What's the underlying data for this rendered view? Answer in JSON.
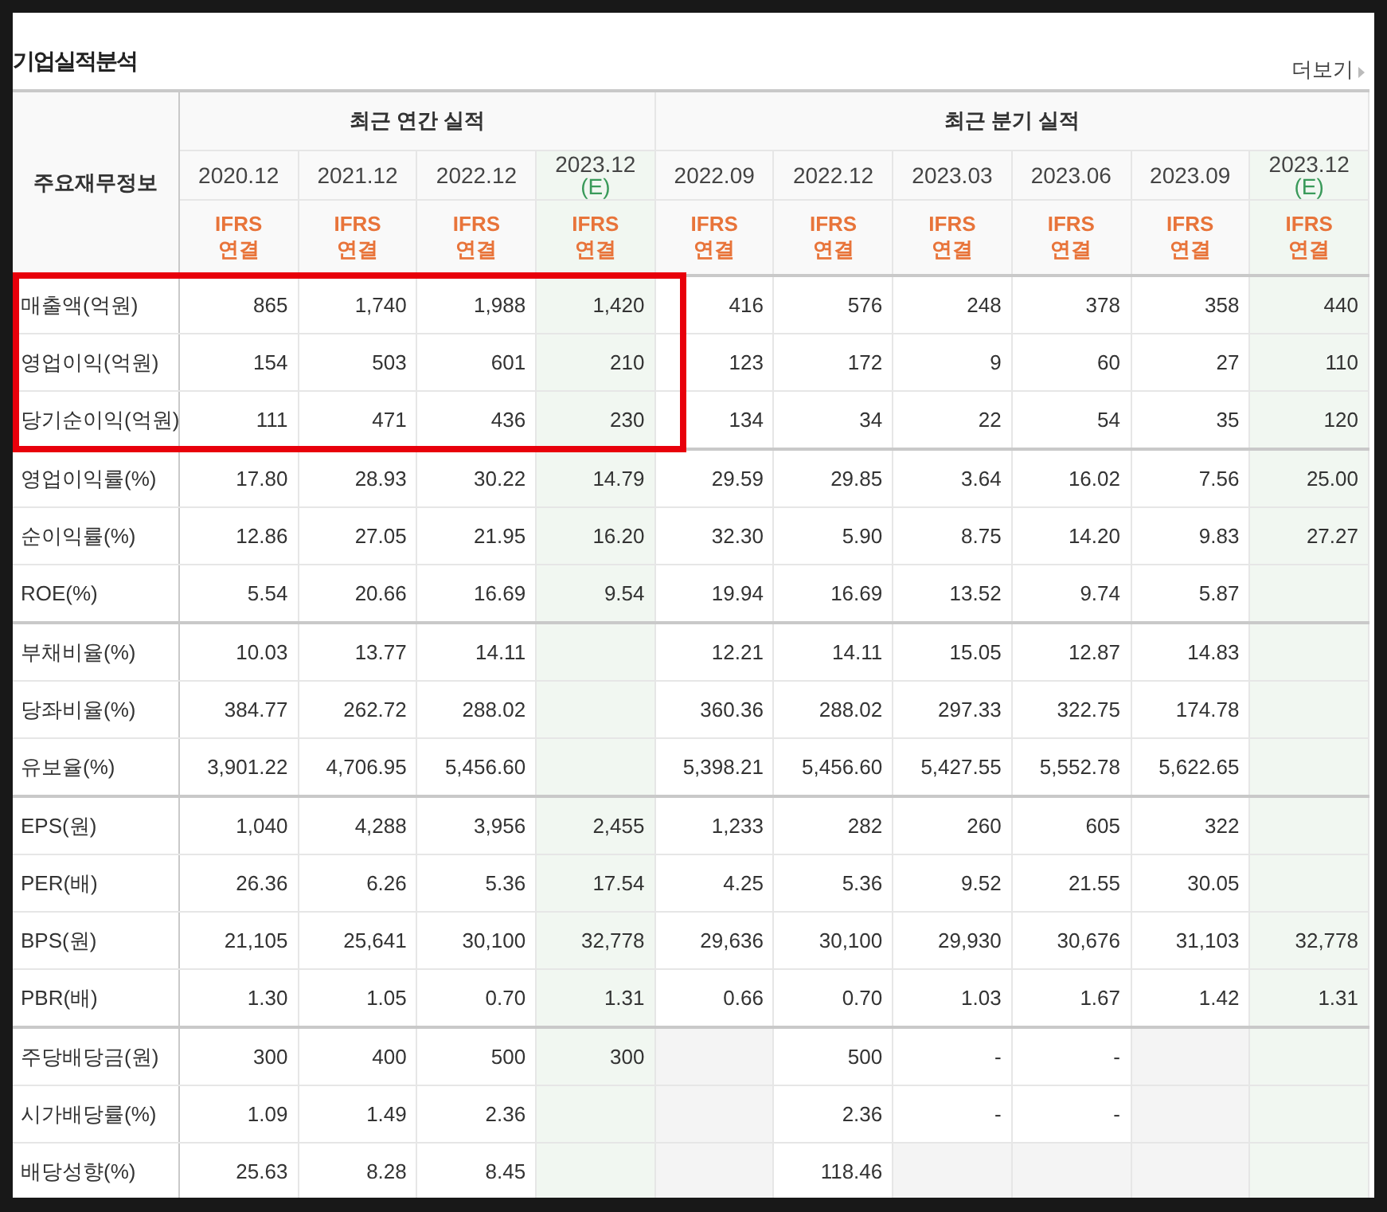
{
  "section_title": "기업실적분석",
  "more_link": "더보기",
  "row_header": "주요재무정보",
  "column_groups": [
    {
      "title": "최근 연간 실적",
      "highlighted": true,
      "columns": [
        {
          "period": "2020.12",
          "basis": [
            "IFRS",
            "연결"
          ]
        },
        {
          "period": "2021.12",
          "basis": [
            "IFRS",
            "연결"
          ]
        },
        {
          "period": "2022.12",
          "basis": [
            "IFRS",
            "연결"
          ]
        },
        {
          "period": "2023.12",
          "estimate": true,
          "estimate_mark": "(E)",
          "basis": [
            "IFRS",
            "연결"
          ]
        }
      ]
    },
    {
      "title": "최근 분기 실적",
      "columns": [
        {
          "period": "2022.09",
          "basis": [
            "IFRS",
            "연결"
          ]
        },
        {
          "period": "2022.12",
          "basis": [
            "IFRS",
            "연결"
          ]
        },
        {
          "period": "2023.03",
          "basis": [
            "IFRS",
            "연결"
          ]
        },
        {
          "period": "2023.06",
          "basis": [
            "IFRS",
            "연결"
          ]
        },
        {
          "period": "2023.09",
          "basis": [
            "IFRS",
            "연결"
          ]
        },
        {
          "period": "2023.12",
          "estimate": true,
          "estimate_mark": "(E)",
          "basis": [
            "IFRS",
            "연결"
          ]
        }
      ]
    }
  ],
  "row_groups": [
    {
      "highlighted": true,
      "rows": [
        {
          "label": "매출액(억원)",
          "cells": [
            {
              "text": "865"
            },
            {
              "text": "1,740"
            },
            {
              "text": "1,988"
            },
            {
              "text": "1,420"
            },
            {
              "text": "416"
            },
            {
              "text": "576"
            },
            {
              "text": "248"
            },
            {
              "text": "378"
            },
            {
              "text": "358"
            },
            {
              "text": "440"
            }
          ]
        },
        {
          "label": "영업이익(억원)",
          "cells": [
            {
              "text": "154"
            },
            {
              "text": "503"
            },
            {
              "text": "601"
            },
            {
              "text": "210"
            },
            {
              "text": "123"
            },
            {
              "text": "172"
            },
            {
              "text": "9"
            },
            {
              "text": "60"
            },
            {
              "text": "27"
            },
            {
              "text": "110"
            }
          ]
        },
        {
          "label": "당기순이익(억원)",
          "cells": [
            {
              "text": "111"
            },
            {
              "text": "471"
            },
            {
              "text": "436"
            },
            {
              "text": "230"
            },
            {
              "text": "134"
            },
            {
              "text": "34"
            },
            {
              "text": "22"
            },
            {
              "text": "54"
            },
            {
              "text": "35"
            },
            {
              "text": "120"
            }
          ]
        }
      ]
    },
    {
      "rows": [
        {
          "label": "영업이익률(%)",
          "cells": [
            {
              "text": "17.80"
            },
            {
              "text": "28.93"
            },
            {
              "text": "30.22"
            },
            {
              "text": "14.79"
            },
            {
              "text": "29.59"
            },
            {
              "text": "29.85"
            },
            {
              "text": "3.64"
            },
            {
              "text": "16.02"
            },
            {
              "text": "7.56"
            },
            {
              "text": "25.00"
            }
          ]
        },
        {
          "label": "순이익률(%)",
          "cells": [
            {
              "text": "12.86"
            },
            {
              "text": "27.05"
            },
            {
              "text": "21.95"
            },
            {
              "text": "16.20"
            },
            {
              "text": "32.30"
            },
            {
              "text": "5.90"
            },
            {
              "text": "8.75"
            },
            {
              "text": "14.20"
            },
            {
              "text": "9.83"
            },
            {
              "text": "27.27"
            }
          ]
        },
        {
          "label": "ROE(%)",
          "cells": [
            {
              "text": "5.54"
            },
            {
              "text": "20.66"
            },
            {
              "text": "16.69"
            },
            {
              "text": "9.54"
            },
            {
              "text": "19.94"
            },
            {
              "text": "16.69"
            },
            {
              "text": "13.52"
            },
            {
              "text": "9.74"
            },
            {
              "text": "5.87"
            },
            {
              "blank": true
            }
          ]
        }
      ]
    },
    {
      "rows": [
        {
          "label": "부채비율(%)",
          "cells": [
            {
              "text": "10.03"
            },
            {
              "text": "13.77"
            },
            {
              "text": "14.11"
            },
            {
              "blank": true
            },
            {
              "text": "12.21"
            },
            {
              "text": "14.11"
            },
            {
              "text": "15.05"
            },
            {
              "text": "12.87"
            },
            {
              "text": "14.83"
            },
            {
              "blank": true
            }
          ]
        },
        {
          "label": "당좌비율(%)",
          "cells": [
            {
              "text": "384.77"
            },
            {
              "text": "262.72"
            },
            {
              "text": "288.02"
            },
            {
              "blank": true
            },
            {
              "text": "360.36"
            },
            {
              "text": "288.02"
            },
            {
              "text": "297.33"
            },
            {
              "text": "322.75"
            },
            {
              "text": "174.78"
            },
            {
              "blank": true
            }
          ]
        },
        {
          "label": "유보율(%)",
          "cells": [
            {
              "text": "3,901.22"
            },
            {
              "text": "4,706.95"
            },
            {
              "text": "5,456.60"
            },
            {
              "blank": true
            },
            {
              "text": "5,398.21"
            },
            {
              "text": "5,456.60"
            },
            {
              "text": "5,427.55"
            },
            {
              "text": "5,552.78"
            },
            {
              "text": "5,622.65"
            },
            {
              "blank": true
            }
          ]
        }
      ]
    },
    {
      "rows": [
        {
          "label": "EPS(원)",
          "cells": [
            {
              "text": "1,040"
            },
            {
              "text": "4,288"
            },
            {
              "text": "3,956"
            },
            {
              "text": "2,455"
            },
            {
              "text": "1,233"
            },
            {
              "text": "282"
            },
            {
              "text": "260"
            },
            {
              "text": "605"
            },
            {
              "text": "322"
            },
            {
              "blank": true
            }
          ]
        },
        {
          "label": "PER(배)",
          "cells": [
            {
              "text": "26.36"
            },
            {
              "text": "6.26"
            },
            {
              "text": "5.36"
            },
            {
              "text": "17.54"
            },
            {
              "text": "4.25"
            },
            {
              "text": "5.36"
            },
            {
              "text": "9.52"
            },
            {
              "text": "21.55"
            },
            {
              "text": "30.05"
            },
            {
              "blank": true
            }
          ]
        },
        {
          "label": "BPS(원)",
          "cells": [
            {
              "text": "21,105"
            },
            {
              "text": "25,641"
            },
            {
              "text": "30,100"
            },
            {
              "text": "32,778"
            },
            {
              "text": "29,636"
            },
            {
              "text": "30,100"
            },
            {
              "text": "29,930"
            },
            {
              "text": "30,676"
            },
            {
              "text": "31,103"
            },
            {
              "text": "32,778"
            }
          ]
        },
        {
          "label": "PBR(배)",
          "cells": [
            {
              "text": "1.30"
            },
            {
              "text": "1.05"
            },
            {
              "text": "0.70"
            },
            {
              "text": "1.31"
            },
            {
              "text": "0.66"
            },
            {
              "text": "0.70"
            },
            {
              "text": "1.03"
            },
            {
              "text": "1.67"
            },
            {
              "text": "1.42"
            },
            {
              "text": "1.31"
            }
          ]
        }
      ]
    },
    {
      "rows": [
        {
          "label": "주당배당금(원)",
          "cells": [
            {
              "text": "300"
            },
            {
              "text": "400"
            },
            {
              "text": "500"
            },
            {
              "text": "300"
            },
            {
              "blank": true
            },
            {
              "text": "500"
            },
            {
              "text": "-"
            },
            {
              "text": "-"
            },
            {
              "blank": true
            },
            {
              "blank": true
            }
          ]
        },
        {
          "label": "시가배당률(%)",
          "cells": [
            {
              "text": "1.09"
            },
            {
              "text": "1.49"
            },
            {
              "text": "2.36"
            },
            {
              "blank": true
            },
            {
              "blank": true
            },
            {
              "text": "2.36"
            },
            {
              "text": "-"
            },
            {
              "text": "-"
            },
            {
              "blank": true
            },
            {
              "blank": true
            }
          ]
        },
        {
          "label": "배당성향(%)",
          "cells": [
            {
              "text": "25.63"
            },
            {
              "text": "8.28"
            },
            {
              "text": "8.45"
            },
            {
              "blank": true
            },
            {
              "blank": true
            },
            {
              "text": "118.46"
            },
            {
              "blank": true
            },
            {
              "blank": true
            },
            {
              "blank": true
            },
            {
              "blank": true
            }
          ]
        }
      ]
    }
  ]
}
